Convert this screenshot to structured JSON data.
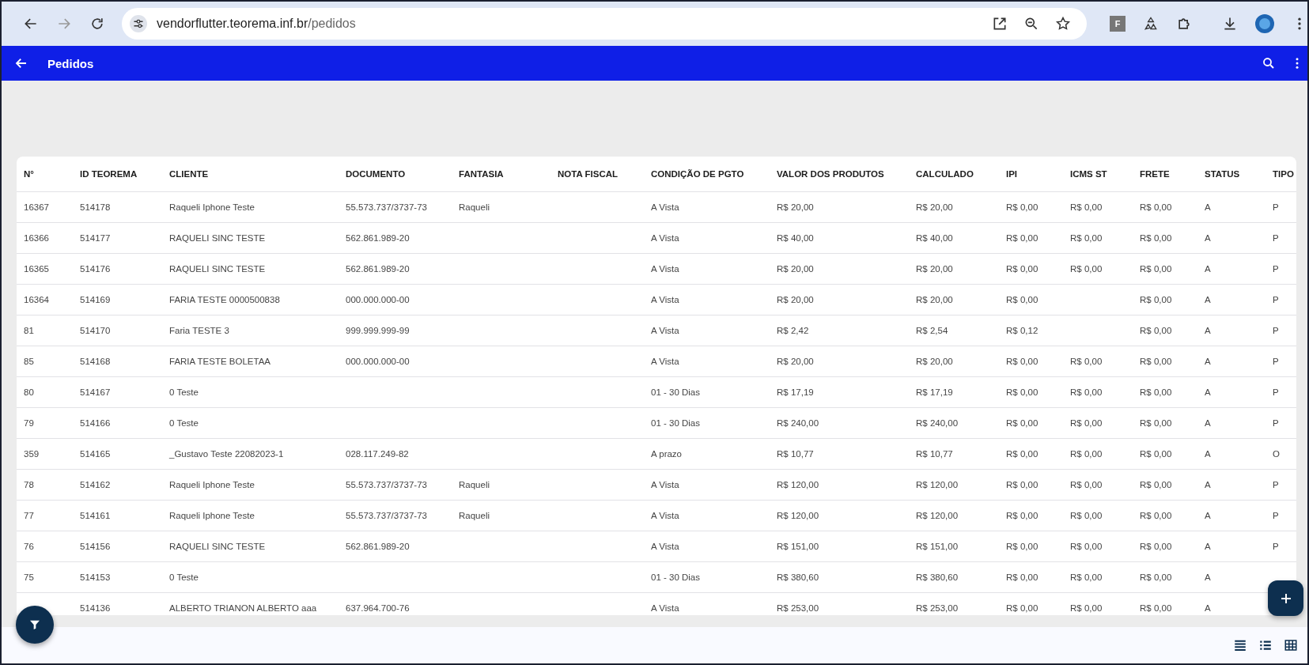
{
  "browser": {
    "url_host": "vendorflutter.teorema.inf.br",
    "url_path": "/pedidos",
    "extension_label": "F"
  },
  "app_bar": {
    "title": "Pedidos"
  },
  "table": {
    "columns": [
      "N°",
      "ID TEOREMA",
      "CLIENTE",
      "DOCUMENTO",
      "FANTASIA",
      "NOTA FISCAL",
      "CONDIÇÃO DE PGTO",
      "VALOR DOS PRODUTOS",
      "CALCULADO",
      "IPI",
      "ICMS ST",
      "FRETE",
      "STATUS",
      "TIPO"
    ],
    "rows": [
      [
        "16367",
        "514178",
        "Raqueli Iphone Teste",
        "55.573.737/3737-73",
        "Raqueli",
        null,
        "A Vista",
        "R$ 20,00",
        "R$ 20,00",
        "R$ 0,00",
        "R$ 0,00",
        "R$ 0,00",
        "A",
        "P"
      ],
      [
        "16366",
        "514177",
        "RAQUELI SINC TESTE",
        "562.861.989-20",
        null,
        null,
        "A Vista",
        "R$ 40,00",
        "R$ 40,00",
        "R$ 0,00",
        "R$ 0,00",
        "R$ 0,00",
        "A",
        "P"
      ],
      [
        "16365",
        "514176",
        "RAQUELI SINC TESTE",
        "562.861.989-20",
        null,
        null,
        "A Vista",
        "R$ 20,00",
        "R$ 20,00",
        "R$ 0,00",
        "R$ 0,00",
        "R$ 0,00",
        "A",
        "P"
      ],
      [
        "16364",
        "514169",
        "FARIA TESTE 0000500838",
        "000.000.000-00",
        null,
        null,
        "A Vista",
        "R$ 20,00",
        "R$ 20,00",
        "R$ 0,00",
        null,
        "R$ 0,00",
        "A",
        "P"
      ],
      [
        "81",
        "514170",
        "Faria TESTE 3",
        "999.999.999-99",
        null,
        null,
        "A Vista",
        "R$ 2,42",
        "R$ 2,54",
        "R$ 0,12",
        null,
        "R$ 0,00",
        "A",
        "P"
      ],
      [
        "85",
        "514168",
        "FARIA TESTE BOLETAA",
        "000.000.000-00",
        null,
        null,
        "A Vista",
        "R$ 20,00",
        "R$ 20,00",
        "R$ 0,00",
        "R$ 0,00",
        "R$ 0,00",
        "A",
        "P"
      ],
      [
        "80",
        "514167",
        "0 Teste",
        null,
        null,
        null,
        "01 - 30 Dias",
        "R$ 17,19",
        "R$ 17,19",
        "R$ 0,00",
        "R$ 0,00",
        "R$ 0,00",
        "A",
        "P"
      ],
      [
        "79",
        "514166",
        "0 Teste",
        null,
        null,
        null,
        "01 - 30 Dias",
        "R$ 240,00",
        "R$ 240,00",
        "R$ 0,00",
        "R$ 0,00",
        "R$ 0,00",
        "A",
        "P"
      ],
      [
        "359",
        "514165",
        "_Gustavo Teste 22082023-1",
        "028.117.249-82",
        null,
        null,
        "A prazo",
        "R$ 10,77",
        "R$ 10,77",
        "R$ 0,00",
        "R$ 0,00",
        "R$ 0,00",
        "A",
        "O"
      ],
      [
        "78",
        "514162",
        "Raqueli Iphone Teste",
        "55.573.737/3737-73",
        "Raqueli",
        null,
        "A Vista",
        "R$ 120,00",
        "R$ 120,00",
        "R$ 0,00",
        "R$ 0,00",
        "R$ 0,00",
        "A",
        "P"
      ],
      [
        "77",
        "514161",
        "Raqueli Iphone Teste",
        "55.573.737/3737-73",
        "Raqueli",
        null,
        "A Vista",
        "R$ 120,00",
        "R$ 120,00",
        "R$ 0,00",
        "R$ 0,00",
        "R$ 0,00",
        "A",
        "P"
      ],
      [
        "76",
        "514156",
        "RAQUELI SINC TESTE",
        "562.861.989-20",
        null,
        null,
        "A Vista",
        "R$ 151,00",
        "R$ 151,00",
        "R$ 0,00",
        "R$ 0,00",
        "R$ 0,00",
        "A",
        "P"
      ],
      [
        "75",
        "514153",
        "0 Teste",
        null,
        null,
        null,
        "01 - 30 Dias",
        "R$ 380,60",
        "R$ 380,60",
        "R$ 0,00",
        "R$ 0,00",
        "R$ 0,00",
        "A",
        null
      ],
      [
        null,
        "514136",
        "ALBERTO TRIANON ALBERTO aaa",
        "637.964.700-76",
        null,
        null,
        "A Vista",
        "R$ 253,00",
        "R$ 253,00",
        "R$ 0,00",
        "R$ 0,00",
        "R$ 0,00",
        "A",
        null
      ]
    ]
  }
}
